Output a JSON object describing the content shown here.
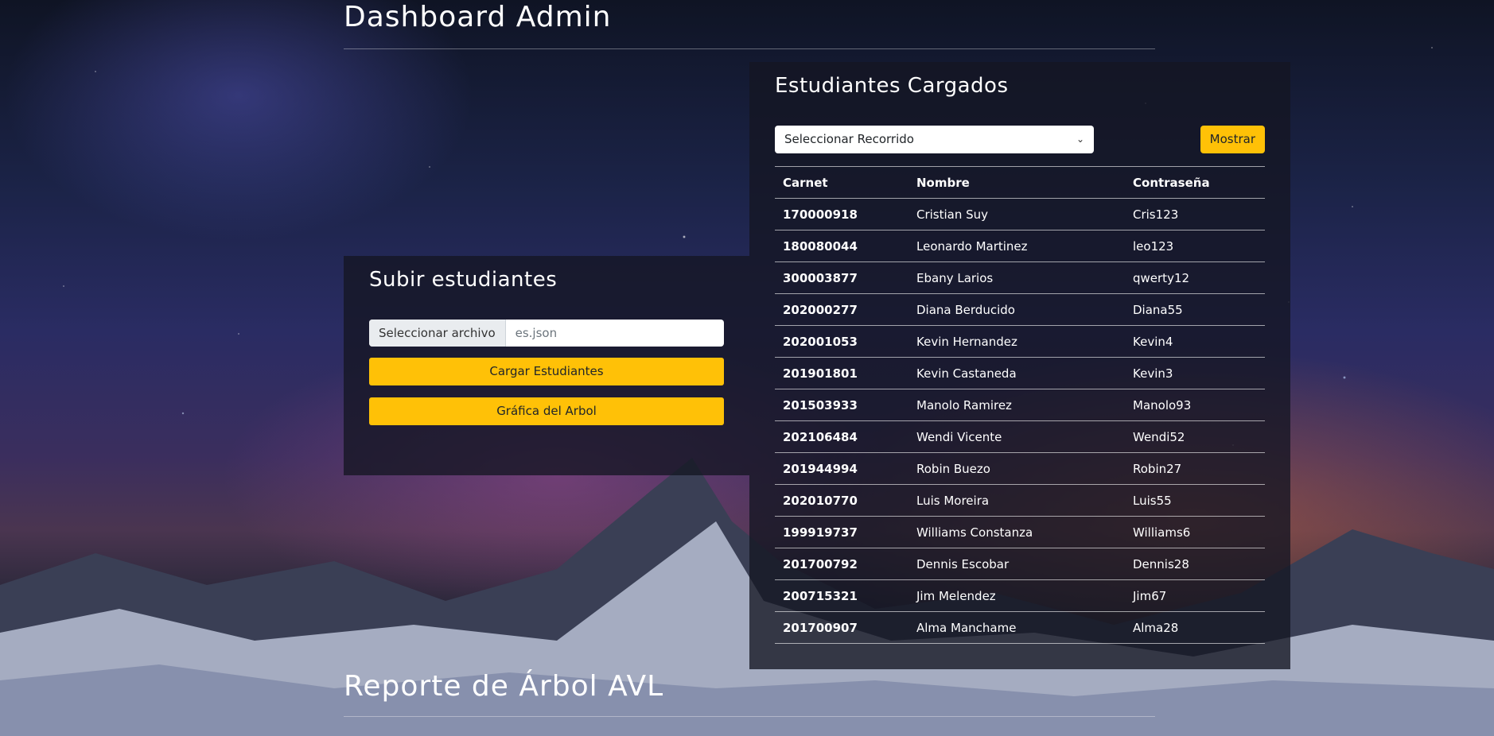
{
  "header": {
    "title": "Dashboard Admin"
  },
  "upload": {
    "title": "Subir estudiantes",
    "file_button": "Seleccionar archivo",
    "file_name": "es.json",
    "load_button": "Cargar Estudiantes",
    "tree_button": "Gráfica del Arbol"
  },
  "students": {
    "title": "Estudiantes Cargados",
    "select_value": "Seleccionar Recorrido",
    "show_button": "Mostrar",
    "columns": [
      "Carnet",
      "Nombre",
      "Contraseña"
    ],
    "rows": [
      [
        "170000918",
        "Cristian Suy",
        "Cris123"
      ],
      [
        "180080044",
        "Leonardo Martinez",
        "leo123"
      ],
      [
        "300003877",
        "Ebany Larios",
        "qwerty12"
      ],
      [
        "202000277",
        "Diana Berducido",
        "Diana55"
      ],
      [
        "202001053",
        "Kevin Hernandez",
        "Kevin4"
      ],
      [
        "201901801",
        "Kevin Castaneda",
        "Kevin3"
      ],
      [
        "201503933",
        "Manolo Ramirez",
        "Manolo93"
      ],
      [
        "202106484",
        "Wendi Vicente",
        "Wendi52"
      ],
      [
        "201944994",
        "Robin Buezo",
        "Robin27"
      ],
      [
        "202010770",
        "Luis Moreira",
        "Luis55"
      ],
      [
        "199919737",
        "Williams Constanza",
        "Williams6"
      ],
      [
        "201700792",
        "Dennis Escobar",
        "Dennis28"
      ],
      [
        "200715321",
        "Jim Melendez",
        "Jim67"
      ],
      [
        "201700907",
        "Alma Manchame",
        "Alma28"
      ]
    ]
  },
  "report": {
    "title": "Reporte de Árbol AVL"
  },
  "colors": {
    "accent": "#ffc107",
    "panel": "#14162390"
  }
}
